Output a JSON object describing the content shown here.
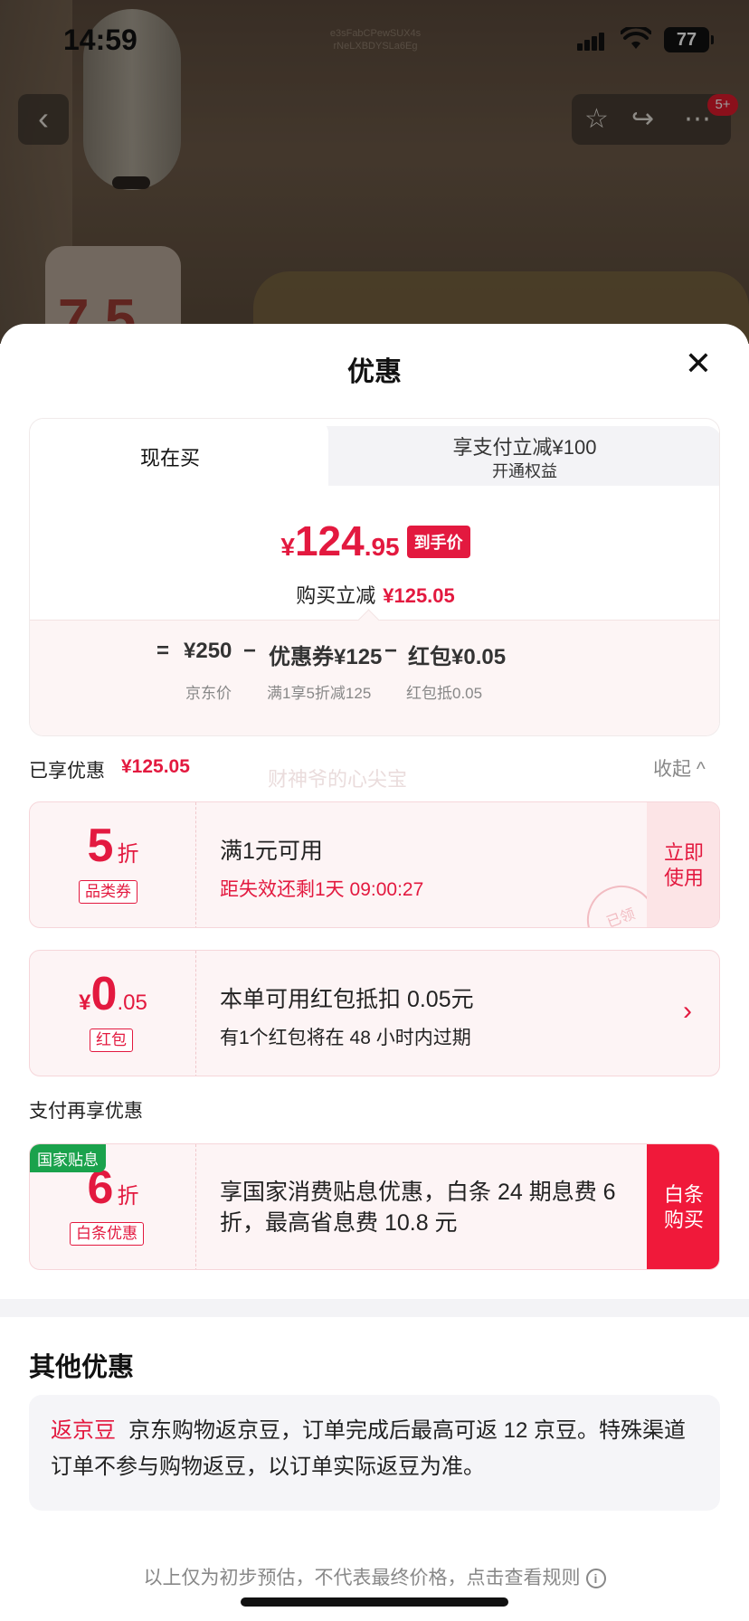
{
  "status_bar": {
    "time": "14:59",
    "notch_text": "e3sFabCPewSUX4s\nrNeLXBDYSLa6Eg",
    "battery": "77"
  },
  "header": {
    "badge": "5+",
    "icons": [
      "back-icon",
      "star-icon",
      "share-icon",
      "more-icon"
    ]
  },
  "background": {
    "promo_number": "7.5"
  },
  "sheet": {
    "title": "优惠",
    "close_label": "✕",
    "tabs": {
      "now": "现在买",
      "pay_main": "享支付立减¥100",
      "pay_sub": "开通权益"
    },
    "price": {
      "symbol": "¥",
      "int": "124",
      "dec": ".95",
      "tag": "到手价"
    },
    "reduce": {
      "label": "购买立减",
      "amount": "¥125.05"
    },
    "formula": {
      "eq": "=",
      "jd_price": "¥250",
      "minus1": "−",
      "coupon": "优惠券¥125",
      "minus2": "−",
      "redpack": "红包¥0.05",
      "jd_price_label": "京东价",
      "coupon_label": "满1享5折减125",
      "redpack_label": "红包抵0.05"
    },
    "enjoyed": {
      "label": "已享优惠",
      "amount": "¥125.05",
      "collapse": "收起 ^",
      "watermark": "财神爷的心尖宝"
    },
    "coupons": [
      {
        "big": "5",
        "unit": "折",
        "label": "品类券",
        "main": "满1元可用",
        "sub": "距失效还剩1天 09:00:27",
        "btn": "立即\n使用",
        "stamp": "已领"
      },
      {
        "sym": "¥",
        "big": "0",
        "dec": ".05",
        "label": "红包",
        "main": "本单可用红包抵扣 0.05元",
        "sub": "有1个红包将在 48 小时内过期"
      }
    ],
    "pay_section": {
      "label": "支付再享优惠",
      "tag": "国家贴息",
      "big": "6",
      "unit": "折",
      "label_small": "白条优惠",
      "main": "享国家消费贴息优惠，白条 24 期息费 6 折，最高省息费 10.8 元",
      "btn": "白条\n购买"
    },
    "other": {
      "title": "其他优惠",
      "tag": "返京豆",
      "text": "京东购物返京豆，订单完成后最高可返 12 京豆。特殊渠道订单不参与购物返豆，以订单实际返豆为准。"
    },
    "footer": "以上仅为初步预估，不代表最终价格，点击查看规则"
  }
}
